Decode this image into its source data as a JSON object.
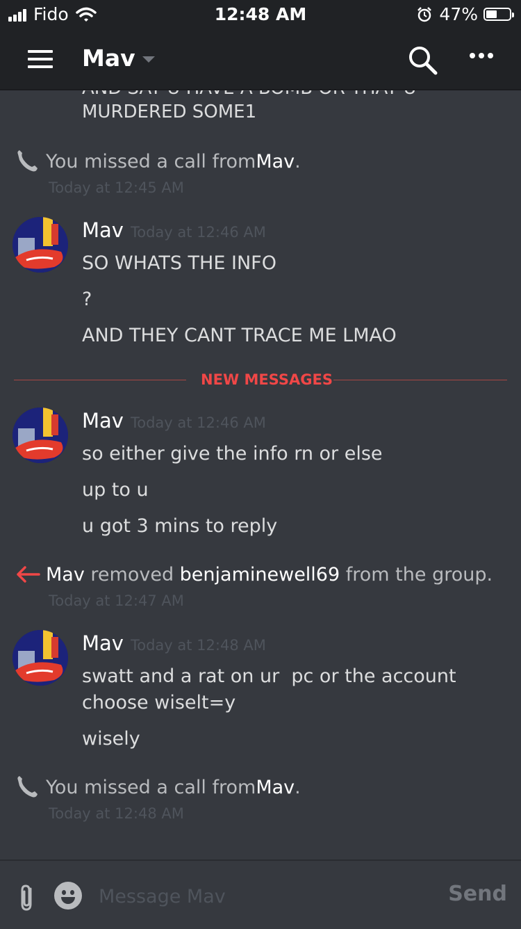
{
  "status_bar": {
    "carrier": "Fido",
    "time": "12:48 AM",
    "battery_percent": "47%",
    "battery_level": 0.47,
    "icons": [
      "signal-icon",
      "wifi-icon",
      "alarm-icon",
      "battery-icon"
    ]
  },
  "header": {
    "title": "Mav",
    "icons": [
      "hamburger-menu-icon",
      "chevron-down-icon",
      "search-icon",
      "more-options-icon"
    ]
  },
  "chat": {
    "cutoff_text": {
      "partial": "AND SAY U HAVE A BOMB OR THAT U",
      "line": "MURDERED SOME1"
    },
    "missed_call_1": {
      "text": "You missed a call from ",
      "name": "Mav",
      "suffix": ".",
      "timestamp": "Today at 12:45 AM"
    },
    "group_1": {
      "author": "Mav",
      "timestamp": "Today at 12:46 AM",
      "lines": [
        "SO WHATS THE INFO",
        "?",
        "AND THEY CANT TRACE ME LMAO"
      ]
    },
    "new_messages_label": "NEW MESSAGES",
    "group_2": {
      "author": "Mav",
      "timestamp": "Today at 12:46 AM",
      "lines": [
        "so either give the info rn or else",
        "up to u",
        "u got 3 mins to reply"
      ]
    },
    "removed_event": {
      "actor": "Mav",
      "action": " removed ",
      "target": "benjaminewell69",
      "suffix": " from the group.",
      "timestamp": "Today at 12:47 AM"
    },
    "group_3": {
      "author": "Mav",
      "timestamp": "Today at 12:48 AM",
      "lines": [
        "swatt and a rat on ur  pc or the account choose wiselt=y",
        "wisely"
      ]
    },
    "missed_call_2": {
      "text": "You missed a call from ",
      "name": "Mav",
      "suffix": ".",
      "timestamp": "Today at 12:48 AM"
    }
  },
  "composer": {
    "placeholder": "Message Mav",
    "send_label": "Send",
    "icons": [
      "attachment-icon",
      "emoji-icon"
    ]
  },
  "colors": {
    "background": "#36393f",
    "header": "#202225",
    "new_messages_red": "#f04747",
    "missed_call_icon": "#b9bbbe",
    "removed_arrow": "#f04747"
  }
}
